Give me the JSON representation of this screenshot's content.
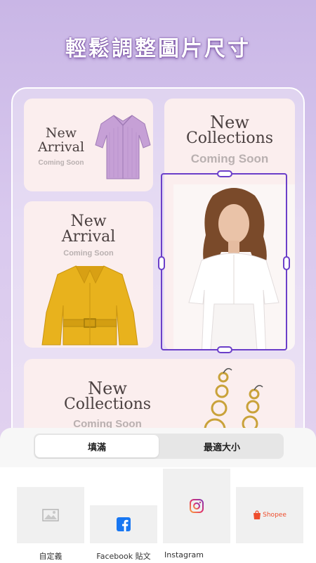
{
  "header": {
    "title": "輕鬆調整圖片尺寸"
  },
  "cards": {
    "card1": {
      "title_line1": "New",
      "title_line2": "Arrival",
      "subtitle": "Coming Soon"
    },
    "card2": {
      "title_line1": "New",
      "title_line2": "Arrival",
      "subtitle": "Coming Soon"
    },
    "card3": {
      "title_line1": "New",
      "title_line2": "Collections",
      "subtitle": "Coming Soon"
    },
    "card4": {
      "title_line1": "New",
      "title_line2": "Collections",
      "subtitle": "Coming Soon"
    }
  },
  "fit_toggle": {
    "fill_label": "填滿",
    "best_size_label": "最適大小",
    "selected": "填滿"
  },
  "templates": [
    {
      "label": "自定義",
      "icon": "image-icon"
    },
    {
      "label": "Facebook 貼文",
      "icon": "facebook-icon"
    },
    {
      "label": "Instagram",
      "icon": "instagram-icon"
    },
    {
      "label": "Shopee",
      "icon": "shopee-icon"
    }
  ],
  "colors": {
    "accent": "#6b3fc9",
    "card_bg": "#fbeeee",
    "facebook": "#1877f2",
    "shopee": "#ee4d2d"
  }
}
